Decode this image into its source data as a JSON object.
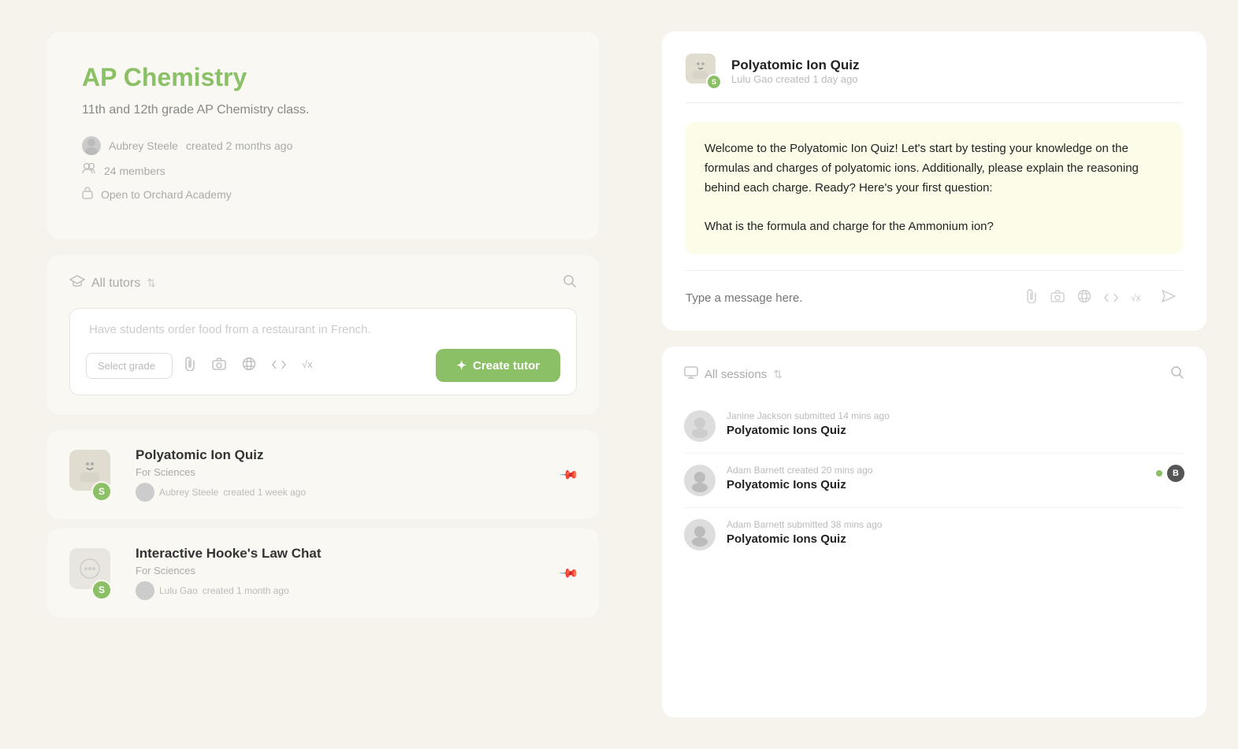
{
  "left": {
    "class": {
      "title": "AP Chemistry",
      "description": "11th and 12th grade AP Chemistry class.",
      "created_by": "Aubrey Steele",
      "created_ago": "created 2 months ago",
      "members": "24 members",
      "access": "Open to Orchard Academy"
    },
    "tutor_section": {
      "label": "All tutors",
      "search_placeholder": "Have students order food from a restaurant in French.",
      "grade_placeholder": "Select grade",
      "create_button": "Create tutor"
    },
    "tutors": [
      {
        "name": "Polyatomic Ion Quiz",
        "subject": "For Sciences",
        "creator": "Aubrey Steele",
        "created_ago": "created 1 week ago",
        "badge": "S",
        "type": "quiz"
      },
      {
        "name": "Interactive Hooke's Law Chat",
        "subject": "For Sciences",
        "creator": "Lulu Gao",
        "created_ago": "created 1 month ago",
        "badge": "S",
        "type": "chat"
      }
    ]
  },
  "right": {
    "chat": {
      "title": "Polyatomic Ion Quiz",
      "subtitle": "Lulu Gao created 1 day ago",
      "badge": "S",
      "message": "Welcome to the Polyatomic Ion Quiz! Let's start by testing your knowledge on the formulas and charges of polyatomic ions. Additionally, please explain the reasoning behind each charge. Ready? Here's your first question:\n\nWhat is the formula and charge for the Ammonium ion?",
      "input_placeholder": "Type a message here."
    },
    "sessions": {
      "label": "All sessions",
      "items": [
        {
          "meta": "Janine Jackson submitted 14 mins ago",
          "name": "Polyatomic Ions Quiz",
          "has_badge": false
        },
        {
          "meta": "Adam Barnett created 20 mins ago",
          "name": "Polyatomic Ions Quiz",
          "has_badge": true,
          "badge_letter": "B"
        },
        {
          "meta": "Adam Barnett submitted 38 mins ago",
          "name": "Polyatomic Ions Quiz",
          "has_badge": false
        }
      ]
    }
  }
}
